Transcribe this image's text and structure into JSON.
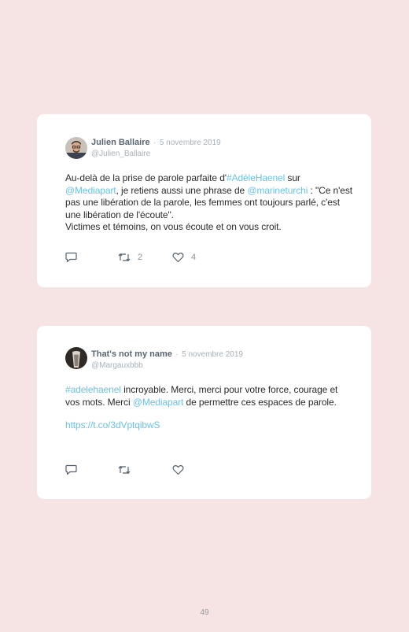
{
  "tweets": [
    {
      "name": "Julien Ballaire",
      "date": "5 novembre 2019",
      "handle": "@Julien_Ballaire",
      "text": {
        "p1": "Au-delà de la prise de parole parfaite d'",
        "hashtag": "#AdèleHaenel",
        "p2": " sur ",
        "mention1": "@Mediapart",
        "p3": ", je retiens aussi une phrase de ",
        "mention2": "@marineturchi",
        "p4": " : \"Ce n'est pas une libération de la parole, les femmes ont toujours parlé, c'est une libération de l'écoute\".",
        "p5": "Victimes et témoins, on vous écoute et on vous croit."
      },
      "retweets": "2",
      "likes": "4"
    },
    {
      "name": "That's not my name",
      "date": "5 novembre 2019",
      "handle": "@Margauxbbb",
      "text": {
        "hashtag": "#adelehaenel",
        "p1": " incroyable. Merci, merci pour votre force, courage et vos mots. Merci ",
        "mention": "@Mediapart",
        "p2": " de permettre ces espaces de parole.",
        "url": "https://t.co/3dVptqibwS"
      }
    }
  ],
  "separator": "·",
  "page_number": "49",
  "colors": {
    "background": "#f6e3e4",
    "card": "#ffffff",
    "link": "#6bc1e8",
    "name": "#5a6571",
    "muted": "#a8b0b8"
  },
  "icons": [
    "reply-icon",
    "retweet-icon",
    "like-icon"
  ]
}
